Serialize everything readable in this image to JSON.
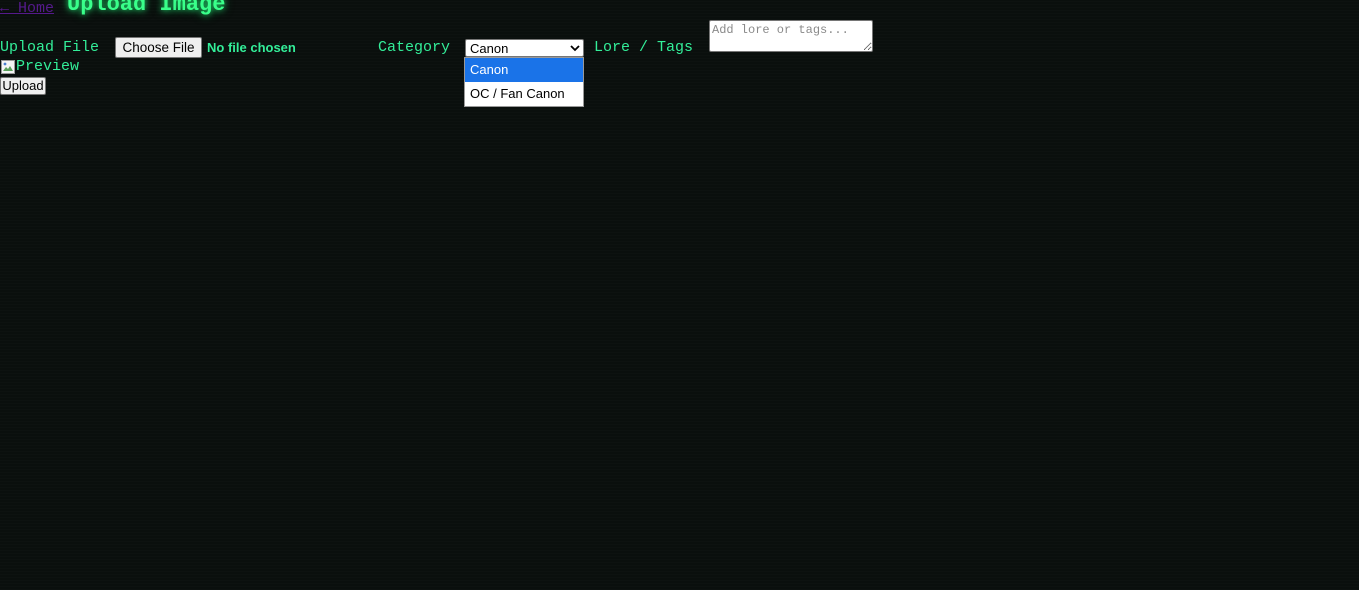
{
  "header": {
    "home_link": "← Home",
    "title": "Upload Image"
  },
  "form": {
    "upload_label": "Upload File",
    "choose_file_label": "Choose File",
    "file_status": "No file chosen",
    "category_label": "Category",
    "category_selected": "Canon",
    "category_options": [
      "Canon",
      "OC / Fan Canon"
    ],
    "lore_label": "Lore / Tags",
    "lore_placeholder": "Add lore or tags...",
    "preview_alt": "Preview",
    "upload_button": "Upload"
  },
  "colors": {
    "background": "#0a0f0d",
    "accent_green": "#33ee99",
    "link_visited": "#551a8b",
    "option_highlight": "#1a73e8"
  }
}
